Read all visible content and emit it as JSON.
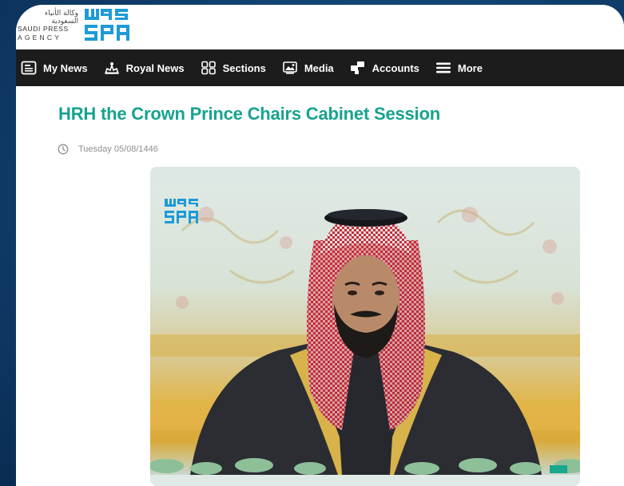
{
  "agency": {
    "arabic_name": "وكالة الأنباء السعودية",
    "english_line1": "SAUDI PRESS",
    "english_line2": "AGENCY",
    "logo_text": "SPA",
    "logo_arabic": "واس"
  },
  "nav": {
    "items": [
      {
        "label": "My News",
        "icon": "news-icon"
      },
      {
        "label": "Royal News",
        "icon": "royal-icon"
      },
      {
        "label": "Sections",
        "icon": "grid-icon"
      },
      {
        "label": "Media",
        "icon": "image-icon"
      },
      {
        "label": "Accounts",
        "icon": "accounts-icon"
      },
      {
        "label": "More",
        "icon": "menu-icon"
      }
    ]
  },
  "article": {
    "headline": "HRH the Crown Prince Chairs Cabinet Session",
    "date": "Tuesday 05/08/1446",
    "image_badge": "SPA"
  },
  "colors": {
    "accent": "#16a38e",
    "nav_bg": "#1c1c1c",
    "logo_blue": "#1e9bd7",
    "background": "#10406e"
  }
}
